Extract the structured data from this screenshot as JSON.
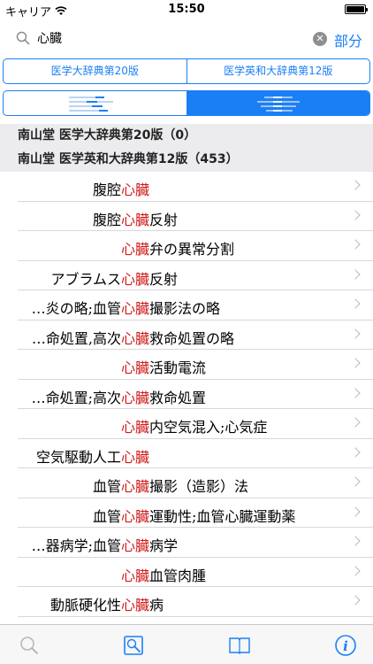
{
  "status": {
    "carrier": "キャリア",
    "time": "15:50"
  },
  "search": {
    "query": "心臓",
    "scope_label": "部分"
  },
  "dictionaries": [
    {
      "label": "医学大辞典第20版"
    },
    {
      "label": "医学英和大辞典第12版"
    }
  ],
  "sections": [
    {
      "label": "南山堂 医学大辞典第20版（0）"
    },
    {
      "label": "南山堂 医学英和大辞典第12版（453）"
    }
  ],
  "results": [
    {
      "pre": "腹腔",
      "hl": "心臓",
      "post": ""
    },
    {
      "pre": "腹腔",
      "hl": "心臓",
      "post": "反射"
    },
    {
      "pre": "",
      "hl": "心臓",
      "post": "弁の異常分割"
    },
    {
      "pre": "アブラムス",
      "hl": "心臓",
      "post": "反射"
    },
    {
      "pre": "…炎の略;血管",
      "hl": "心臓",
      "post": "撮影法の略"
    },
    {
      "pre": "…命処置,高次",
      "hl": "心臓",
      "post": "救命処置の略"
    },
    {
      "pre": "",
      "hl": "心臓",
      "post": "活動電流"
    },
    {
      "pre": "…命処置;高次",
      "hl": "心臓",
      "post": "救命処置"
    },
    {
      "pre": "",
      "hl": "心臓",
      "post": "内空気混入;心気症"
    },
    {
      "pre": "空気駆動人工",
      "hl": "心臓",
      "post": ""
    },
    {
      "pre": "血管",
      "hl": "心臓",
      "post": "撮影（造影）法"
    },
    {
      "pre": "血管",
      "hl": "心臓",
      "post": "運動性;血管心臓運動薬"
    },
    {
      "pre": "…器病学;血管",
      "hl": "心臓",
      "post": "病学"
    },
    {
      "pre": "",
      "hl": "心臓",
      "post": "血管肉腫"
    },
    {
      "pre": "動脈硬化性",
      "hl": "心臓",
      "post": "病"
    }
  ],
  "tabs": [
    {
      "icon": "search-icon",
      "active": false
    },
    {
      "icon": "image-search-icon",
      "active": true
    },
    {
      "icon": "book-icon",
      "active": false
    },
    {
      "icon": "info-icon",
      "active": false
    }
  ],
  "colors": {
    "accent": "#1a7ff5",
    "highlight": "#d11a1a",
    "section_bg": "#ececef"
  }
}
